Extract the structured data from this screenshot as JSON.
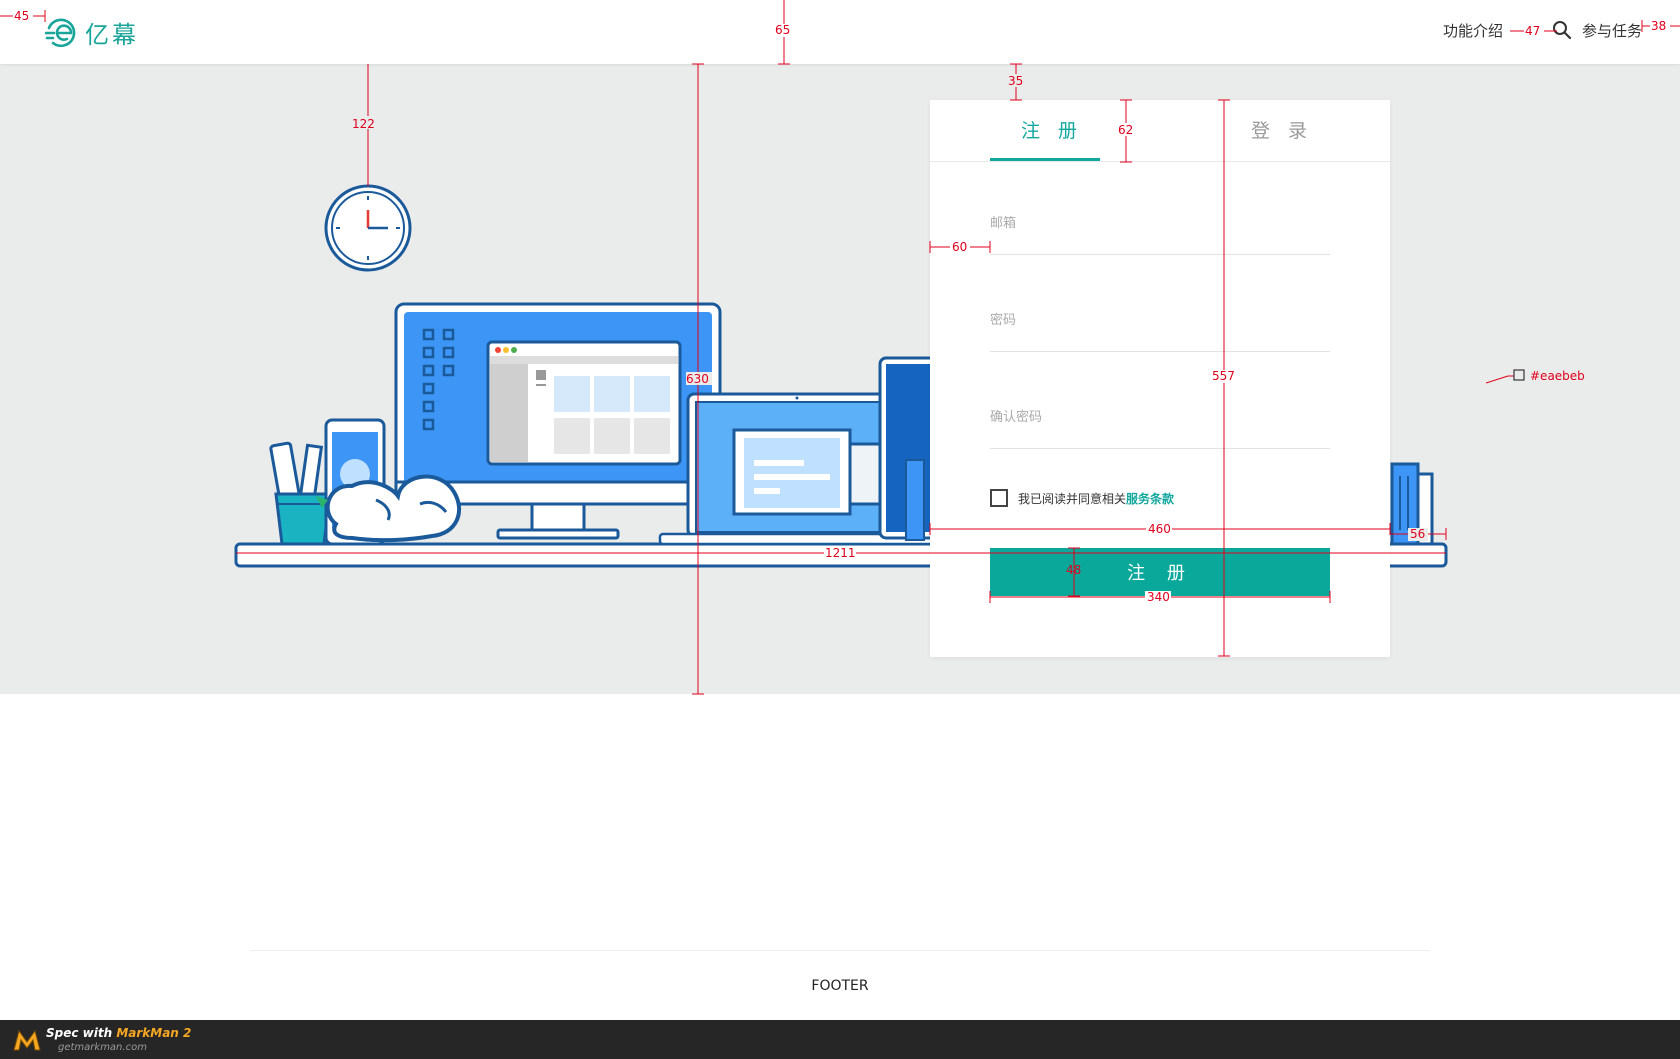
{
  "header": {
    "brand": "亿幕",
    "nav": {
      "features": "功能介绍",
      "tasks": "参与任务"
    }
  },
  "hero": {
    "background_color": "#eaebeb"
  },
  "form": {
    "tabs": {
      "register": "注 册",
      "login": "登 录"
    },
    "fields": {
      "email_placeholder": "邮箱",
      "password_placeholder": "密码",
      "confirm_placeholder": "确认密码"
    },
    "agree_text": "我已阅读并同意相关",
    "terms_link": "服务条款",
    "submit_label": "注 册",
    "accent_color": "#0aa89b"
  },
  "footer": {
    "text": "FOOTER"
  },
  "markman": {
    "prefix": "Spec with ",
    "name": "MarkMan 2",
    "site": "getmarkman.com"
  },
  "spec": {
    "header_left_margin": "45",
    "header_height": "65",
    "nav_gap": "47",
    "header_right_margin": "38",
    "illus_top": "122",
    "hero_height": "630",
    "card_top": "35",
    "tab_height": "62",
    "card_padding": "60",
    "card_height": "557",
    "swatch": "#eaebeb",
    "card_width": "460",
    "card_right": "56",
    "desk_width": "1211",
    "button_height": "48",
    "button_width": "340"
  }
}
